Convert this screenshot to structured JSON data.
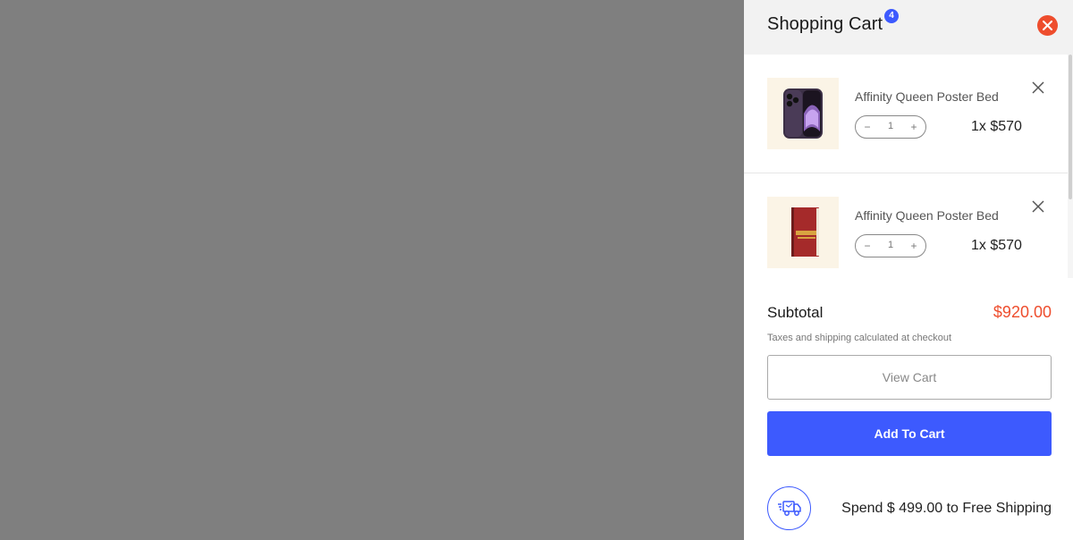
{
  "cart": {
    "title": "Shopping Cart",
    "count": "4",
    "items": [
      {
        "name": "Affinity Queen Poster Bed",
        "quantity": "1",
        "price": "1x $570",
        "image": "phone-product-image"
      },
      {
        "name": "Affinity Queen Poster Bed",
        "quantity": "1",
        "price": "1x $570",
        "image": "book-product-image"
      }
    ],
    "qty_minus": "−",
    "qty_plus": "+"
  },
  "summary": {
    "subtotal_label": "Subtotal",
    "subtotal_value": "$920.00",
    "tax_note": "Taxes and shipping calculated at checkout",
    "view_cart_label": "View Cart",
    "add_to_cart_label": "Add To Cart",
    "shipping_text": "Spend $ 499.00 to Free Shipping"
  },
  "colors": {
    "accent": "#3d5afe",
    "price": "#ee4d2d",
    "overlay": "#7f7f7f"
  }
}
